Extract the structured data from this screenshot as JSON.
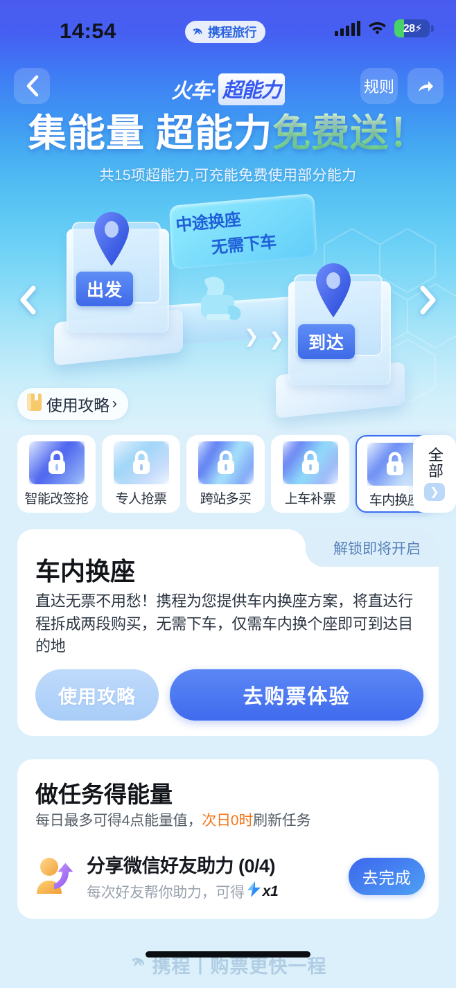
{
  "status_bar": {
    "time": "14:54",
    "app_pill_label": "携程旅行",
    "battery_level": "28",
    "signal_icon": "signal-bars-icon",
    "wifi_icon": "wifi-icon",
    "battery_icon": "battery-charging-icon"
  },
  "nav": {
    "back_icon": "chevron-left-icon",
    "title_prefix": "火车·",
    "title_badge": "超能力",
    "rules_label": "规则",
    "share_icon": "share-arrow-icon"
  },
  "headline": {
    "line_white": "集能量 超能力",
    "line_accent": "免费送！",
    "subtitle": "共15项超能力,可充能免费使用部分能力"
  },
  "carousel": {
    "prev_icon": "chevron-left-icon",
    "next_icon": "chevron-right-icon",
    "banner_line1": "中途换座",
    "banner_line2": "无需下车",
    "origin_label": "出发",
    "destination_label": "到达"
  },
  "guide_pill": {
    "icon": "notebook-icon",
    "label": "使用攻略",
    "chevron": "›"
  },
  "tabs": {
    "items": [
      {
        "label": "智能改签抢",
        "locked": true,
        "active": false
      },
      {
        "label": "专人抢票",
        "locked": true,
        "active": false
      },
      {
        "label": "跨站多买",
        "locked": true,
        "active": false
      },
      {
        "label": "上车补票",
        "locked": true,
        "active": false
      },
      {
        "label": "车内换座",
        "locked": true,
        "active": true
      }
    ],
    "all_label": "全部",
    "all_chevron_icon": "chevron-right-icon",
    "lock_icon": "lock-icon"
  },
  "detail": {
    "badge": "解锁即将开启",
    "title": "车内换座",
    "description": "直达无票不用愁！携程为您提供车内换座方案，将直达行程拆成两段购买，无需下车，仅需车内换个座即可到达目的地",
    "secondary_button": "使用攻略",
    "primary_button": "去购票体验"
  },
  "task": {
    "title": "做任务得能量",
    "subtitle_prefix": "每日最多可得4点能量值，",
    "subtitle_highlight": "次日0时",
    "subtitle_suffix": "刷新任务",
    "rows": [
      {
        "icon": "share-friend-icon",
        "name": "分享微信好友助力 (0/4)",
        "hint_prefix": "每次好友帮你助力，可得",
        "hint_bolt": "⚡",
        "hint_multiplier": "x1",
        "button": "去完成"
      }
    ]
  },
  "footer": {
    "logo_icon": "ctrip-dolphin-icon",
    "text": "携程丨购票更快一程"
  },
  "colors": {
    "brand_blue": "#3f6bee",
    "hero_top": "#4a5cf0",
    "hero_bottom": "#dcf2fb",
    "accent_green": "#9ef08f",
    "page_bg": "#dcf0fb",
    "highlight_orange": "#f5761a"
  }
}
